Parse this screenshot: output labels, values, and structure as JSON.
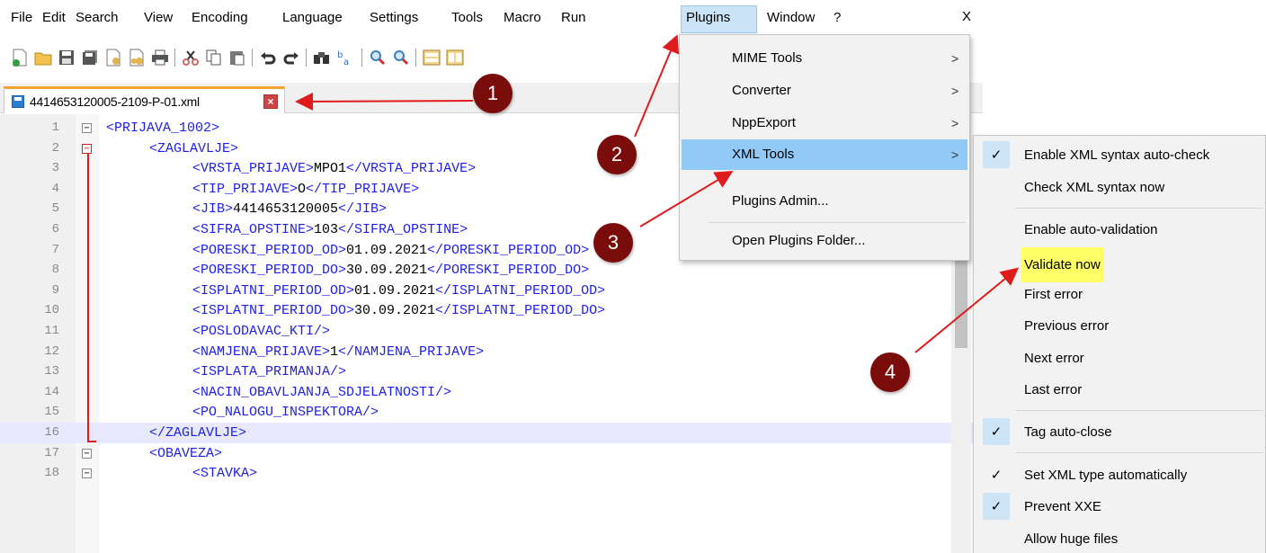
{
  "menubar": {
    "items": [
      "File",
      "Edit",
      "Search",
      "View",
      "Encoding",
      "Language",
      "Settings",
      "Tools",
      "Macro",
      "Run",
      "Plugins",
      "Window",
      "?"
    ],
    "close": "X",
    "active": "Plugins"
  },
  "toolbar": {
    "icons": [
      "new-file-icon",
      "open-file-icon",
      "save-icon",
      "save-all-icon",
      "close-icon",
      "close-all-icon",
      "print-icon",
      "cut-icon",
      "copy-icon",
      "paste-icon",
      "undo-icon",
      "redo-icon",
      "find-icon",
      "replace-icon",
      "zoom-in-icon",
      "zoom-out-icon",
      "sync-vertical-icon",
      "sync-horizontal-icon"
    ]
  },
  "tab": {
    "filename": "4414653120005-2109-P-01.xml"
  },
  "editor": {
    "lines": [
      {
        "num": "1",
        "text": "<PRIJAVA_1002>"
      },
      {
        "num": "2",
        "text": "<ZAGLAVLJE>"
      },
      {
        "num": "3",
        "open": "<VRSTA_PRIJAVE>",
        "value": "MPO1",
        "close": "</VRSTA_PRIJAVE>"
      },
      {
        "num": "4",
        "open": "<TIP_PRIJAVE>",
        "value": "O",
        "close": "</TIP_PRIJAVE>"
      },
      {
        "num": "5",
        "open": "<JIB>",
        "value": "4414653120005",
        "close": "</JIB>"
      },
      {
        "num": "6",
        "open": "<SIFRA_OPSTINE>",
        "value": "103",
        "close": "</SIFRA_OPSTINE>"
      },
      {
        "num": "7",
        "open": "<PORESKI_PERIOD_OD>",
        "value": "01.09.2021",
        "close": "</PORESKI_PERIOD_OD>"
      },
      {
        "num": "8",
        "open": "<PORESKI_PERIOD_DO>",
        "value": "30.09.2021",
        "close": "</PORESKI_PERIOD_DO>"
      },
      {
        "num": "9",
        "open": "<ISPLATNI_PERIOD_OD>",
        "value": "01.09.2021",
        "close": "</ISPLATNI_PERIOD_OD>"
      },
      {
        "num": "10",
        "open": "<ISPLATNI_PERIOD_DO>",
        "value": "30.09.2021",
        "close": "</ISPLATNI_PERIOD_DO>"
      },
      {
        "num": "11",
        "text": "<POSLODAVAC_KTI/>"
      },
      {
        "num": "12",
        "open": "<NAMJENA_PRIJAVE>",
        "value": "1",
        "close": "</NAMJENA_PRIJAVE>"
      },
      {
        "num": "13",
        "text": "<ISPLATA_PRIMANJA/>"
      },
      {
        "num": "14",
        "text": "<NACIN_OBAVLJANJA_SDJELATNOSTI/>"
      },
      {
        "num": "15",
        "text": "<PO_NALOGU_INSPEKTORA/>"
      },
      {
        "num": "16",
        "text": "</ZAGLAVLJE>"
      },
      {
        "num": "17",
        "text": "<OBAVEZA>"
      },
      {
        "num": "18",
        "text": "<STAVKA>"
      }
    ]
  },
  "plugins_menu": {
    "items": [
      {
        "label": "MIME Tools",
        "submenu": true
      },
      {
        "label": "Converter",
        "submenu": true
      },
      {
        "label": "NppExport",
        "submenu": true
      },
      {
        "label": "XML Tools",
        "submenu": true
      },
      {
        "label": "Plugins Admin...",
        "submenu": false
      },
      {
        "label": "Open Plugins Folder...",
        "submenu": false
      }
    ],
    "arrow": ">"
  },
  "xml_tools_menu": {
    "items": [
      {
        "label": "Enable XML syntax auto-check",
        "checked": true
      },
      {
        "label": "Check XML syntax now",
        "checked": false
      },
      {
        "label": "Enable auto-validation",
        "checked": false
      },
      {
        "label": "Validate now",
        "checked": false,
        "highlighted": true
      },
      {
        "label": "First error",
        "checked": false
      },
      {
        "label": "Previous error",
        "checked": false
      },
      {
        "label": "Next error",
        "checked": false
      },
      {
        "label": "Last error",
        "checked": false
      },
      {
        "label": "Tag auto-close",
        "checked": true
      },
      {
        "label": "Set XML type automatically",
        "checked": true
      },
      {
        "label": "Prevent XXE",
        "checked": true
      },
      {
        "label": "Allow huge files",
        "checked": false
      }
    ],
    "check_glyph": "✓"
  },
  "annotations": {
    "badges": [
      "1",
      "2",
      "3",
      "4"
    ],
    "color": "#7b0c0c",
    "arrow_color": "#e01b1b"
  }
}
